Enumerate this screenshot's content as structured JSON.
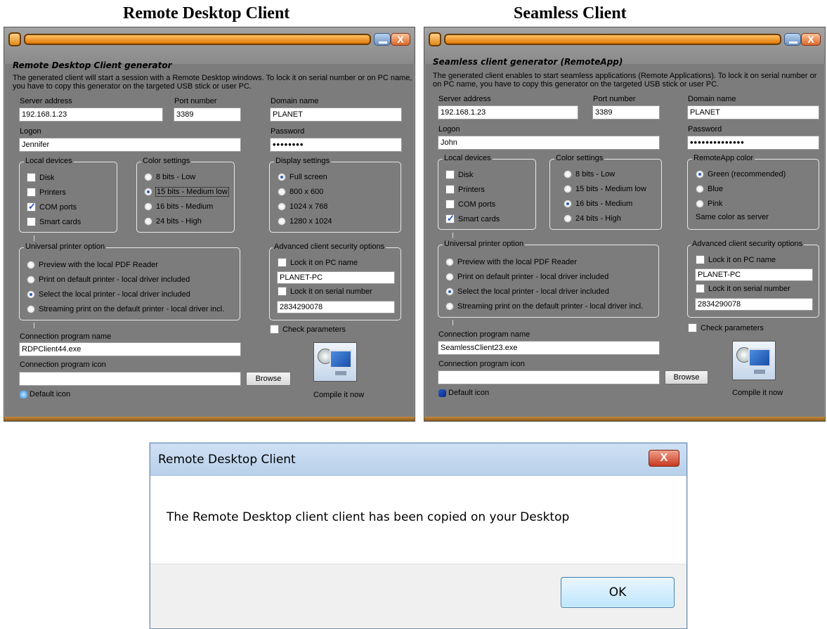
{
  "captions": {
    "left": "Remote Desktop Client",
    "right": "Seamless Client"
  },
  "rdp": {
    "heading": "Remote Desktop Client generator",
    "description": "The generated client will start a session with a Remote Desktop windows. To lock it on serial number or on PC name, you have to copy this generator on the targeted USB stick or user PC.",
    "server_label": "Server address",
    "server_value": "192.168.1.23",
    "port_label": "Port number",
    "port_value": "3389",
    "domain_label": "Domain name",
    "domain_value": "PLANET",
    "logon_label": "Logon",
    "logon_value": "Jennifer",
    "password_label": "Password",
    "password_value": "••••••••",
    "local_devices": {
      "legend": "Local devices",
      "items": [
        {
          "label": "Disk",
          "checked": false
        },
        {
          "label": "Printers",
          "checked": false
        },
        {
          "label": "COM ports",
          "checked": true
        },
        {
          "label": "Smart cards",
          "checked": false
        }
      ]
    },
    "color_settings": {
      "legend": "Color settings",
      "items": [
        {
          "label": "8 bits - Low",
          "selected": false
        },
        {
          "label": "15 bits - Medium low",
          "selected": true
        },
        {
          "label": "16 bits - Medium",
          "selected": false
        },
        {
          "label": "24 bits - High",
          "selected": false
        }
      ]
    },
    "third_group": {
      "legend": "Display settings",
      "items": [
        {
          "label": "Full screen",
          "selected": true
        },
        {
          "label": "800 x 600",
          "selected": false
        },
        {
          "label": "1024 x 768",
          "selected": false
        },
        {
          "label": "1280 x 1024",
          "selected": false
        }
      ]
    },
    "printer": {
      "legend": "Universal printer option",
      "items": [
        {
          "label": "Preview with the local PDF Reader",
          "selected": false
        },
        {
          "label": "Print on default printer - local driver included",
          "selected": false
        },
        {
          "label": "Select the local printer - local driver included",
          "selected": true
        },
        {
          "label": "Streaming print on the default printer - local driver incl.",
          "selected": false
        }
      ]
    },
    "security": {
      "legend": "Advanced client security options",
      "lock_pc_label": "Lock it on PC name",
      "pc_name": "PLANET-PC",
      "lock_serial_label": "Lock it on serial number",
      "serial": "2834290078"
    },
    "check_params": "Check parameters",
    "program_name_label": "Connection program name",
    "program_name": "RDPClient44.exe",
    "program_icon_label": "Connection program icon",
    "program_icon": "",
    "browse": "Browse",
    "default_icon": "Default icon",
    "compile": "Compile it now"
  },
  "seamless": {
    "heading": "Seamless client generator (RemoteApp)",
    "description": "The generated client enables to start seamless applications (Remote Applications). To lock it on serial number or on PC name, you have to copy this generator on the targeted USB stick or user PC.",
    "server_label": "Server address",
    "server_value": "192.168.1.23",
    "port_label": "Port number",
    "port_value": "3389",
    "domain_label": "Domain name",
    "domain_value": "PLANET",
    "logon_label": "Logon",
    "logon_value": "John",
    "password_label": "Password",
    "password_value": "••••••••••••••",
    "local_devices": {
      "legend": "Local devices",
      "items": [
        {
          "label": "Disk",
          "checked": false
        },
        {
          "label": "Printers",
          "checked": false
        },
        {
          "label": "COM ports",
          "checked": false
        },
        {
          "label": "Smart cards",
          "checked": true
        }
      ]
    },
    "color_settings": {
      "legend": "Color settings",
      "items": [
        {
          "label": "8 bits - Low",
          "selected": false
        },
        {
          "label": "15 bits - Medium low",
          "selected": false
        },
        {
          "label": "16 bits - Medium",
          "selected": true
        },
        {
          "label": "24 bits - High",
          "selected": false
        }
      ]
    },
    "third_group": {
      "legend": "RemoteApp color",
      "items": [
        {
          "label": "Green (recommended)",
          "selected": true
        },
        {
          "label": "Blue",
          "selected": false
        },
        {
          "label": "Pink",
          "selected": false
        }
      ],
      "note": "Same color as server"
    },
    "printer": {
      "legend": "Universal printer option",
      "items": [
        {
          "label": "Preview with the local PDF Reader",
          "selected": false
        },
        {
          "label": "Print on default printer - local driver included",
          "selected": false
        },
        {
          "label": "Select the local printer - local driver included",
          "selected": true
        },
        {
          "label": "Streaming print on the default printer - local driver incl.",
          "selected": false
        }
      ]
    },
    "security": {
      "legend": "Advanced client security options",
      "lock_pc_label": "Lock it on PC name",
      "pc_name": "PLANET-PC",
      "lock_serial_label": "Lock it on serial number",
      "serial": "2834290078"
    },
    "check_params": "Check parameters",
    "program_name_label": "Connection program name",
    "program_name": "SeamlessClient23.exe",
    "program_icon_label": "Connection program icon",
    "program_icon": "",
    "browse": "Browse",
    "default_icon": "Default icon",
    "compile": "Compile it now"
  },
  "dialog": {
    "title": "Remote Desktop Client",
    "close_glyph": "X",
    "message": "The Remote Desktop client client has been copied on your Desktop",
    "ok": "OK"
  },
  "colors": {
    "window_bg": "#7c7c7c",
    "title_orange": "#e07a0a",
    "dialog_title": "#cfe0f4"
  }
}
